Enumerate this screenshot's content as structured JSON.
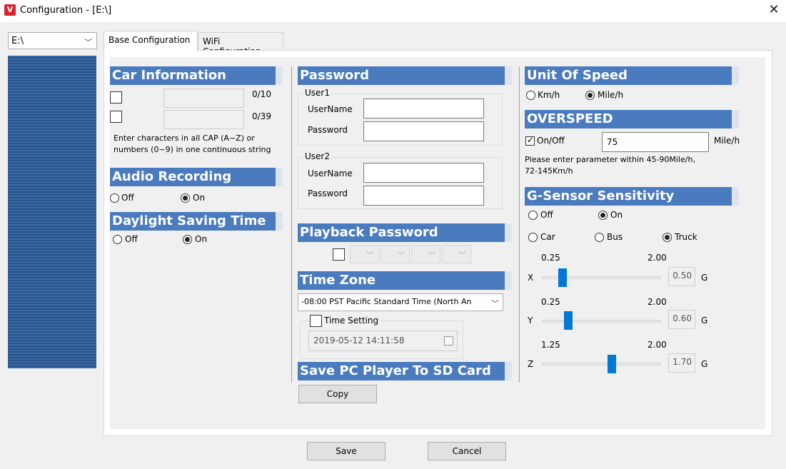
{
  "window": {
    "title": "Configuration - [E:\\]"
  },
  "drive": {
    "value": "E:\\"
  },
  "tabs": [
    {
      "label": "Base Configuration"
    },
    {
      "label": "WiFi Configuration"
    }
  ],
  "car_info": {
    "heading": "Car Information",
    "field1_count": "0/10",
    "field2_count": "0/39",
    "hint_line1": "Enter characters in all CAP (A~Z) or",
    "hint_line2": "numbers (0~9) in one continuous string"
  },
  "audio": {
    "heading": "Audio Recording",
    "off": "Off",
    "on": "On"
  },
  "dst": {
    "heading": "Daylight Saving Time",
    "off": "Off",
    "on": "On"
  },
  "password": {
    "heading": "Password",
    "user1": "User1",
    "user2": "User2",
    "username_label": "UserName",
    "password_label": "Password"
  },
  "playback": {
    "heading": "Playback Password"
  },
  "timezone": {
    "heading": "Time Zone",
    "value": "-08:00 PST Pacific Standard Time (North An",
    "time_setting_label": "Time Setting",
    "datetime": "2019-05-12 14:11:58"
  },
  "save_pc": {
    "heading": "Save PC Player To SD Card",
    "copy_label": "Copy"
  },
  "speed": {
    "heading": "Unit Of Speed",
    "kmh": "Km/h",
    "mileh": "Mile/h"
  },
  "overspeed": {
    "heading": "OVERSPEED",
    "onoff_label": "On/Off",
    "value": "75",
    "unit": "Mile/h",
    "hint_line1": "Please enter parameter within 45-90Mile/h,",
    "hint_line2": "72-145Km/h"
  },
  "gsensor": {
    "heading": "G-Sensor Sensitivity",
    "off": "Off",
    "on": "On",
    "car": "Car",
    "bus": "Bus",
    "truck": "Truck",
    "unit": "G",
    "axes": [
      {
        "axis": "X",
        "min": "0.25",
        "max": "2.00",
        "value": "0.50"
      },
      {
        "axis": "Y",
        "min": "0.25",
        "max": "2.00",
        "value": "0.60"
      },
      {
        "axis": "Z",
        "min": "1.25",
        "max": "2.00",
        "value": "1.70"
      }
    ]
  },
  "footer": {
    "save_label": "Save",
    "cancel_label": "Cancel"
  },
  "colors": {
    "section_header": "#4a7bbf",
    "slider_thumb": "#0078d7",
    "app_icon": "#d9232d"
  }
}
